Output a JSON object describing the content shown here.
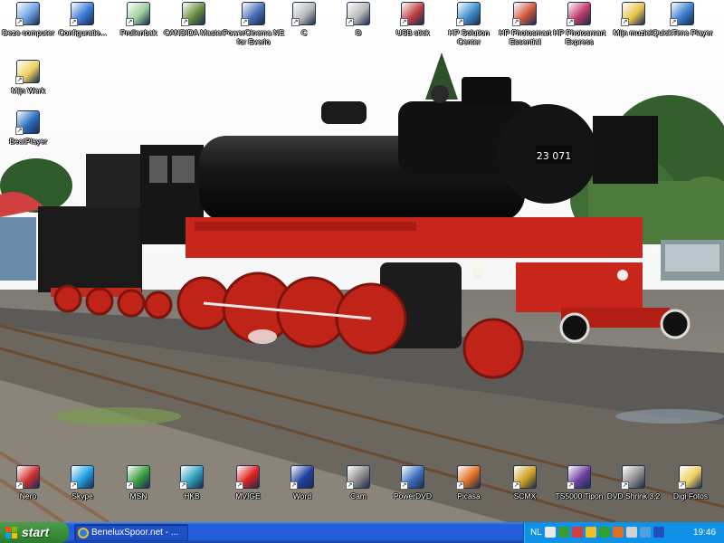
{
  "desktop": {
    "icons_top": [
      {
        "label": "Deze computer",
        "name": "my-computer-icon",
        "color": "#6fa3e0"
      },
      {
        "label": "Configuratie...",
        "name": "control-panel-icon",
        "color": "#3b7bd8"
      },
      {
        "label": "Prullenbak",
        "name": "recycle-bin-icon",
        "color": "#9fd0a0"
      },
      {
        "label": "CANDIDA Master",
        "name": "candida-master-icon",
        "color": "#6b8e3f"
      },
      {
        "label": "PowerCinema NE for Everio",
        "name": "powercinema-icon",
        "color": "#4a6fb5"
      },
      {
        "label": "C",
        "name": "drive-c-icon",
        "color": "#b9b9b9"
      },
      {
        "label": "D",
        "name": "drive-d-icon",
        "color": "#b9b9b9"
      },
      {
        "label": "USB stick",
        "name": "usb-stick-icon",
        "color": "#c04040"
      },
      {
        "label": "HP Solution Center",
        "name": "hp-solution-center-icon",
        "color": "#3f8fcf"
      },
      {
        "label": "HP Photosmart Essential",
        "name": "hp-photosmart-essential-icon",
        "color": "#d05a40"
      },
      {
        "label": "HP Photosmart Express",
        "name": "hp-photosmart-express-icon",
        "color": "#c03a6a"
      },
      {
        "label": "Mijn muziek",
        "name": "my-music-icon",
        "color": "#e9c54a"
      },
      {
        "label": "QuickTime Player",
        "name": "quicktime-icon",
        "color": "#3a7fd0"
      }
    ],
    "icons_left": [
      {
        "label": "Mijn Werk",
        "name": "my-work-folder-icon",
        "color": "#f0d060"
      },
      {
        "label": "BeatPlayer",
        "name": "beatplayer-icon",
        "color": "#2a6fc0"
      }
    ],
    "icons_bottom": [
      {
        "label": "Nero",
        "name": "nero-icon",
        "color": "#d03030"
      },
      {
        "label": "Skype",
        "name": "skype-icon",
        "color": "#20a0e0"
      },
      {
        "label": "MSN",
        "name": "msn-icon",
        "color": "#3aa040"
      },
      {
        "label": "HKB",
        "name": "hkb-icon",
        "color": "#2fa0c0"
      },
      {
        "label": "MVIGE",
        "name": "mvige-icon",
        "color": "#e02020"
      },
      {
        "label": "Word",
        "name": "word-icon",
        "color": "#2040a0"
      },
      {
        "label": "Cam",
        "name": "cam-icon",
        "color": "#8a8a8a"
      },
      {
        "label": "PowerDVD",
        "name": "powerdvd-icon",
        "color": "#4070c0"
      },
      {
        "label": "Picasa",
        "name": "picasa-icon",
        "color": "#e07020"
      },
      {
        "label": "SCMX",
        "name": "scmx-icon",
        "color": "#d0a020"
      },
      {
        "label": "TS5000 Tipon",
        "name": "ts5000-icon",
        "color": "#7040a0"
      },
      {
        "label": "DVD Shrink 3.2",
        "name": "dvd-shrink-icon",
        "color": "#909090"
      },
      {
        "label": "Digi Fotos",
        "name": "digi-fotos-icon",
        "color": "#f0d060"
      }
    ],
    "wallpaper": {
      "loco_number": "23 071"
    }
  },
  "taskbar": {
    "start_label": "start",
    "window_label": "BeneluxSpoor.net - ...",
    "language": "NL",
    "clock": "19:46",
    "colors": {
      "start": "#3c8f3c",
      "bar": "#245edc",
      "tray": "#0f91e8"
    },
    "tray_icons": [
      "speaker-icon",
      "network-icon",
      "security-icon",
      "update-icon",
      "messenger-icon",
      "antivirus-icon",
      "printer-icon",
      "chat-icon",
      "display-icon"
    ]
  }
}
